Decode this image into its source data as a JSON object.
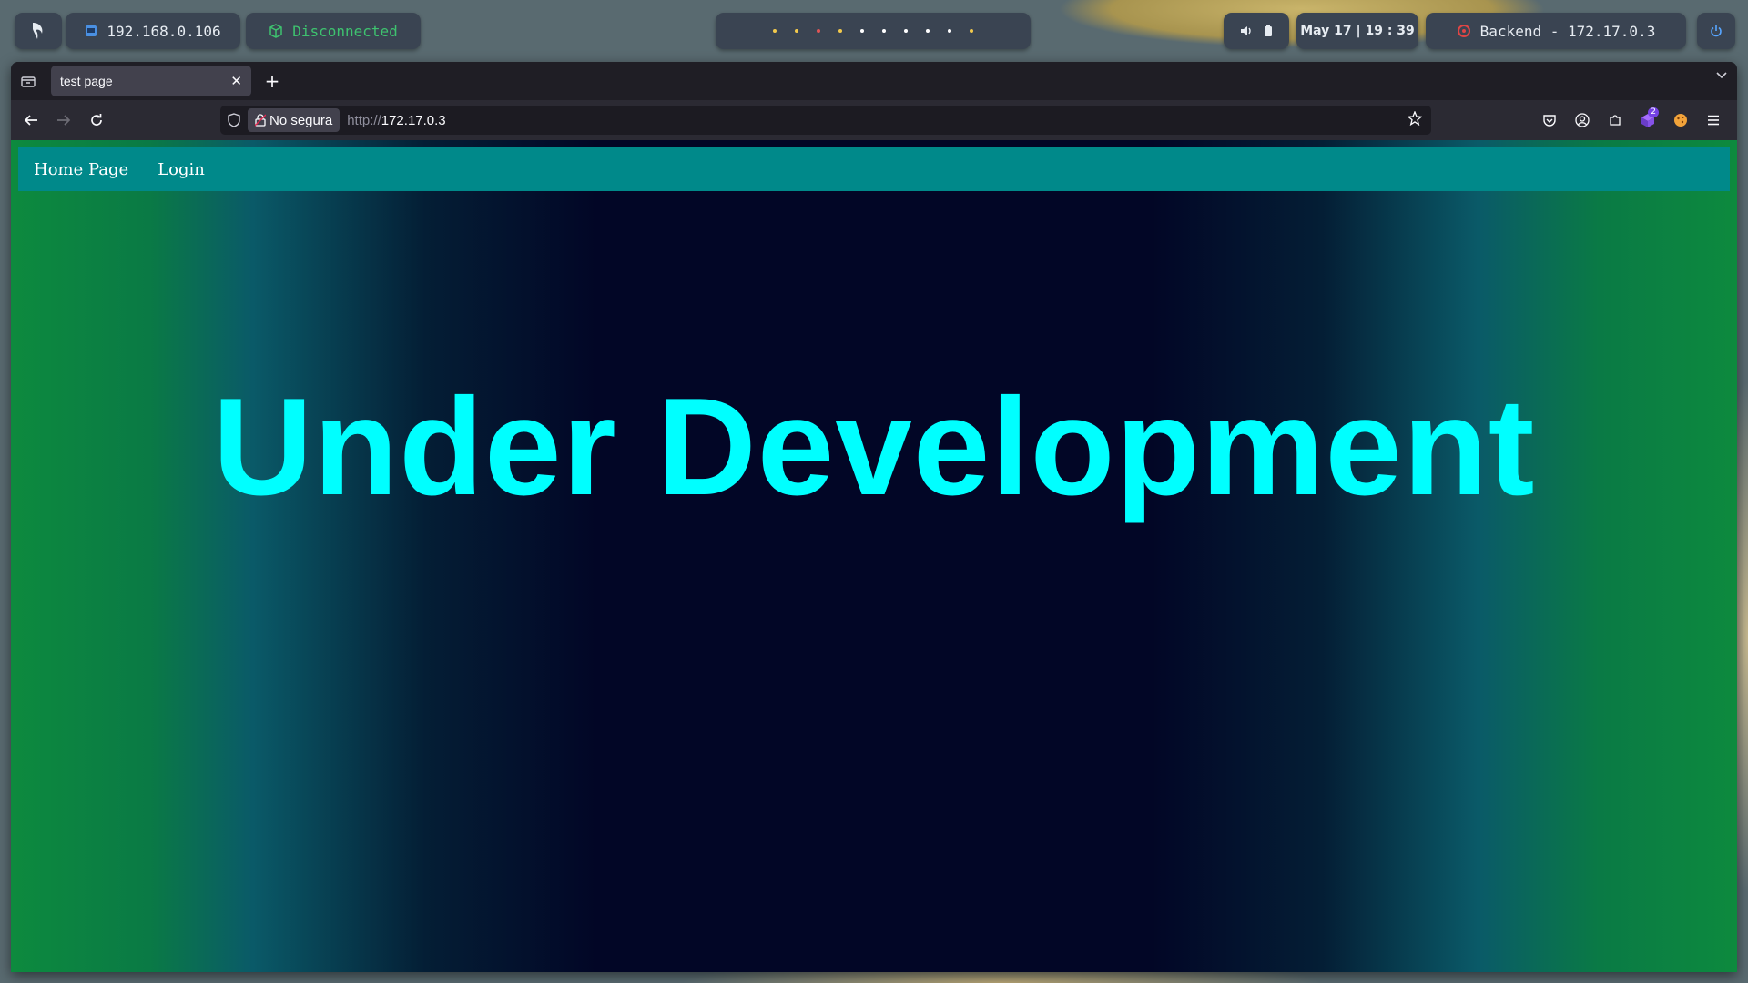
{
  "desktop": {
    "ip_address": "192.168.0.106",
    "vpn_status": "Disconnected",
    "workspace_dot_colors": [
      "#f2c94c",
      "#f2c94c",
      "#e05555",
      "#f2c94c",
      "#ffffff",
      "#ffffff",
      "#ffffff",
      "#ffffff",
      "#ffffff",
      "#f2c94c"
    ],
    "clock": "May 17  |  19 : 39",
    "target": "Backend - 172.17.0.3",
    "colors": {
      "vpn_green": "#3ec26f",
      "target_red": "#e04545",
      "power_blue": "#57a5ff"
    }
  },
  "browser": {
    "tab_title": "test page",
    "security_label": "No segura",
    "url_scheme": "http://",
    "url_host": "172.17.0.3",
    "extensions_badge": "2"
  },
  "page": {
    "nav": [
      "Home Page",
      "Login"
    ],
    "headline": "Under Development",
    "colors": {
      "nav_bg": "#00898a",
      "headline": "#00ffff",
      "edge_green": "#0d8a3e",
      "center_navy": "#020626"
    }
  }
}
